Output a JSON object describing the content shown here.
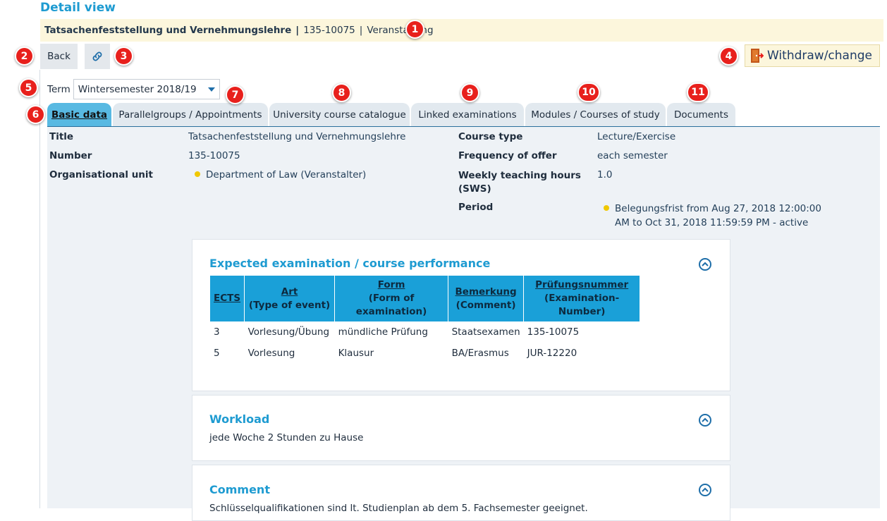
{
  "page_title": "Detail view",
  "info_bar": {
    "course_name": "Tatsachenfeststellung und Vernehmungslehre",
    "separator": "|",
    "course_number": "135-10075",
    "pipe": "|",
    "type": "Veranstaltung"
  },
  "toolbar": {
    "back_label": "Back",
    "link_icon": "link-icon",
    "withdraw_label": "Withdraw/change",
    "withdraw_icon": "door-exit-icon"
  },
  "term": {
    "label": "Term",
    "selected": "Wintersemester 2018/19"
  },
  "tabs": [
    {
      "label": "Basic data",
      "active": true
    },
    {
      "label": "Parallelgroups / Appointments"
    },
    {
      "label": "University course catalogue"
    },
    {
      "label": "Linked examinations"
    },
    {
      "label": "Modules / Courses of study"
    },
    {
      "label": "Documents"
    }
  ],
  "basic_data": {
    "left": [
      {
        "label": "Title",
        "value": "Tatsachenfeststellung und Vernehmungslehre"
      },
      {
        "label": "Number",
        "value": "135-10075"
      },
      {
        "label": "Organisational unit",
        "value": "Department of Law (Veranstalter)"
      }
    ],
    "right": [
      {
        "label": "Course type",
        "value": "Lecture/Exercise"
      },
      {
        "label": "Frequency of offer",
        "value": "each semester"
      },
      {
        "label_line1": "Weekly teaching hours",
        "label_line2": "(SWS)",
        "value": "1.0"
      },
      {
        "label": "Period",
        "value_line1": "Belegungsfrist from Aug 27, 2018 12:00:00",
        "value_line2": "AM to Oct 31, 2018 11:59:59 PM - active"
      }
    ]
  },
  "exam_card": {
    "title": "Expected examination / course performance",
    "headers": [
      {
        "l1": "ECTS",
        "l2": ""
      },
      {
        "l1": "Art",
        "l2": "(Type of event)"
      },
      {
        "l1": "Form",
        "l2": "(Form of examination)"
      },
      {
        "l1": "Bemerkung",
        "l2": "(Comment)"
      },
      {
        "l1": "Prüfungsnummer",
        "l2": "(Examination-Number)"
      }
    ],
    "rows": [
      [
        "3",
        "Vorlesung/Übung",
        "mündliche Prüfung",
        "Staatsexamen",
        "135-10075"
      ],
      [
        "5",
        "Vorlesung",
        "Klausur",
        "BA/Erasmus",
        "JUR-12220"
      ]
    ]
  },
  "workload_card": {
    "title": "Workload",
    "text": "jede Woche 2 Stunden zu Hause"
  },
  "comment_card": {
    "title": "Comment",
    "text": "Schlüsselqualifikationen sind lt. Studienplan ab dem 5. Fachsemester geeignet."
  },
  "badges": [
    "1",
    "2",
    "3",
    "4",
    "5",
    "6",
    "7",
    "8",
    "9",
    "10",
    "11"
  ],
  "colors": {
    "accent": "#1e9bd1",
    "badge": "#e8201c",
    "info_bg": "#fcf6dc",
    "active_tab": "#58b9e2",
    "table_header": "#1aa0d8"
  }
}
